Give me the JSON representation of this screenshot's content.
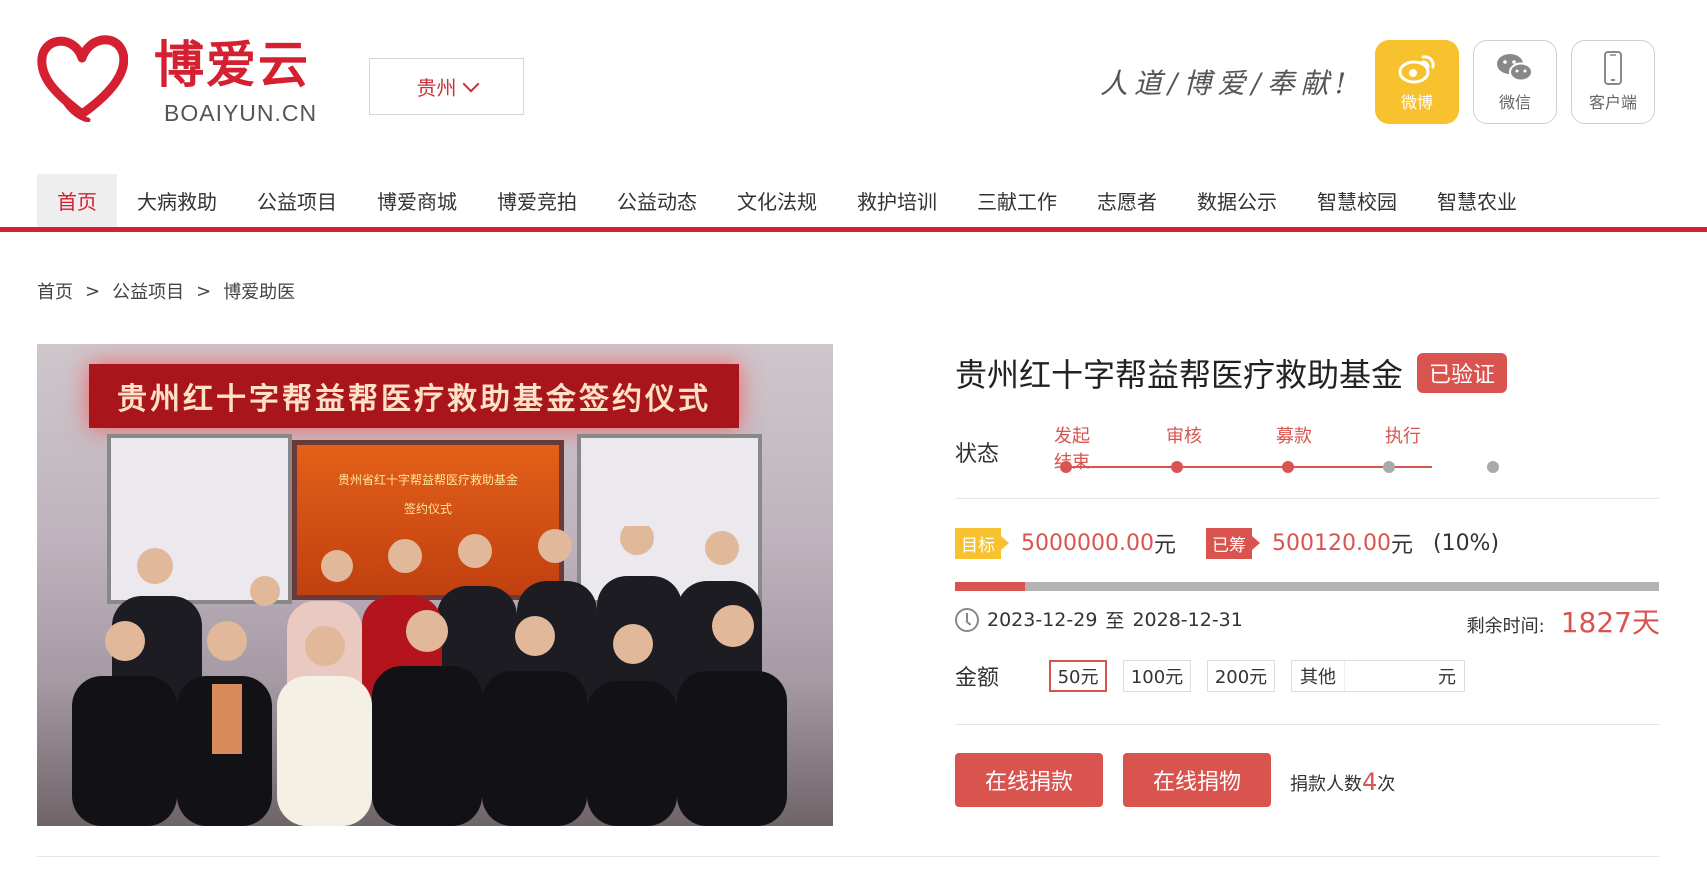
{
  "header": {
    "logo_cn": "博爱云",
    "logo_en": "BOAIYUN.CN",
    "city": "贵州",
    "slogan": "人道/博爱/奉献!",
    "social": [
      {
        "label": "微博",
        "icon": "weibo-icon"
      },
      {
        "label": "微信",
        "icon": "wechat-icon"
      },
      {
        "label": "客户端",
        "icon": "phone-icon"
      }
    ]
  },
  "nav": {
    "items": [
      "首页",
      "大病救助",
      "公益项目",
      "博爱商城",
      "博爱竞拍",
      "公益动态",
      "文化法规",
      "救护培训",
      "三献工作",
      "志愿者",
      "数据公示",
      "智慧校园",
      "智慧农业"
    ],
    "active": "首页"
  },
  "breadcrumb": {
    "items": [
      "首页",
      "公益项目",
      "博爱助医"
    ],
    "separator": ">"
  },
  "photo": {
    "banner": "贵州红十字帮益帮医疗救助基金签约仪式",
    "screen_line1": "贵州省红十字帮益帮医疗救助基金",
    "screen_line2": "签约仪式"
  },
  "project": {
    "title": "贵州红十字帮益帮医疗救助基金",
    "verified": "已验证",
    "status_label": "状态",
    "steps": [
      "发起",
      "审核",
      "募款",
      "执行"
    ],
    "step_sub": "结束",
    "goal_tag": "目标",
    "goal_value": "5000000.00",
    "raised_tag": "已筹",
    "raised_value": "500120.00",
    "unit": "元",
    "percent_text": "(10%)",
    "progress": 0.1,
    "date_start": "2023-12-29",
    "date_to": "至",
    "date_end": "2028-12-31",
    "remain_label": "剩余时间:",
    "remain_value": "1827天",
    "amount_label": "金额",
    "amount_options": [
      "50元",
      "100元",
      "200元"
    ],
    "amount_selected": "50元",
    "other_label": "其他",
    "other_unit": "元",
    "btn_donate": "在线捐款",
    "btn_goods": "在线捐物",
    "donors_label": "捐款人数",
    "donors_count": "4",
    "donors_suffix": "次"
  },
  "colors": {
    "brand_red": "#d42030",
    "accent_red": "#d9534f",
    "weibo_yellow": "#f7c22e",
    "goal_yellow": "#f7c22e"
  }
}
